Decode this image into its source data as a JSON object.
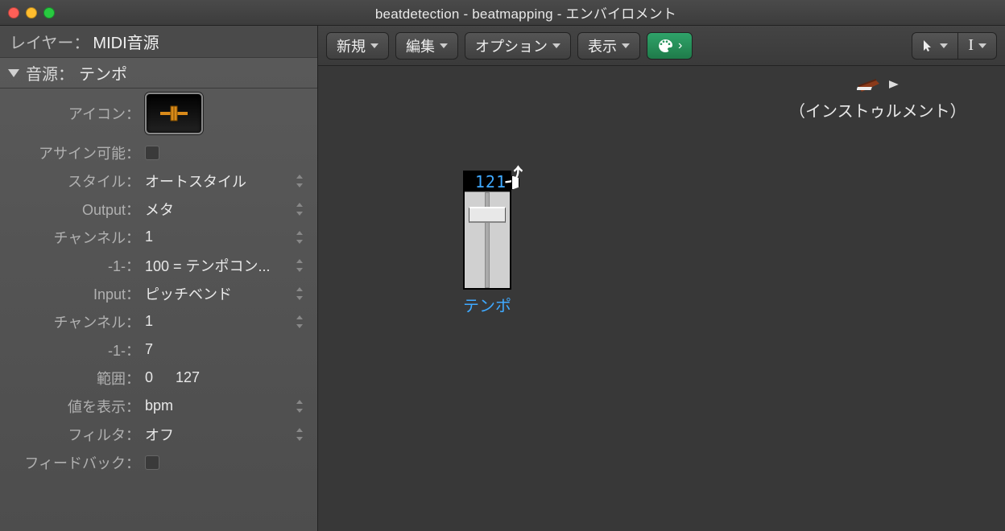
{
  "window": {
    "title": "beatdetection - beatmapping - エンバイロメント"
  },
  "layer": {
    "label": "レイヤー：",
    "value": "MIDI音源"
  },
  "source": {
    "label": "音源：",
    "value": "テンポ"
  },
  "inspector": {
    "icon_label": "アイコン：",
    "assignable_label": "アサイン可能：",
    "style": {
      "label": "スタイル：",
      "value": "オートスタイル"
    },
    "output": {
      "label": "Output：",
      "value": "メタ"
    },
    "out_channel": {
      "label": "チャンネル：",
      "value": "1"
    },
    "out_neg1": {
      "label": "-1-：",
      "value": "100 = テンポコン..."
    },
    "input": {
      "label": "Input：",
      "value": "ピッチベンド"
    },
    "in_channel": {
      "label": "チャンネル：",
      "value": "1"
    },
    "in_neg1": {
      "label": "-1-：",
      "value": "7"
    },
    "range": {
      "label": "範囲：",
      "min": "0",
      "max": "127"
    },
    "show_value": {
      "label": "値を表示：",
      "value": "bpm"
    },
    "filter": {
      "label": "フィルタ：",
      "value": "オフ"
    },
    "feedback_label": "フィードバック："
  },
  "toolbar": {
    "new": "新規",
    "edit": "編集",
    "options": "オプション",
    "view": "表示"
  },
  "canvas": {
    "tempo_object": {
      "value": "121",
      "label": "テンポ"
    },
    "instrument": {
      "label": "（インストゥルメント）"
    }
  }
}
